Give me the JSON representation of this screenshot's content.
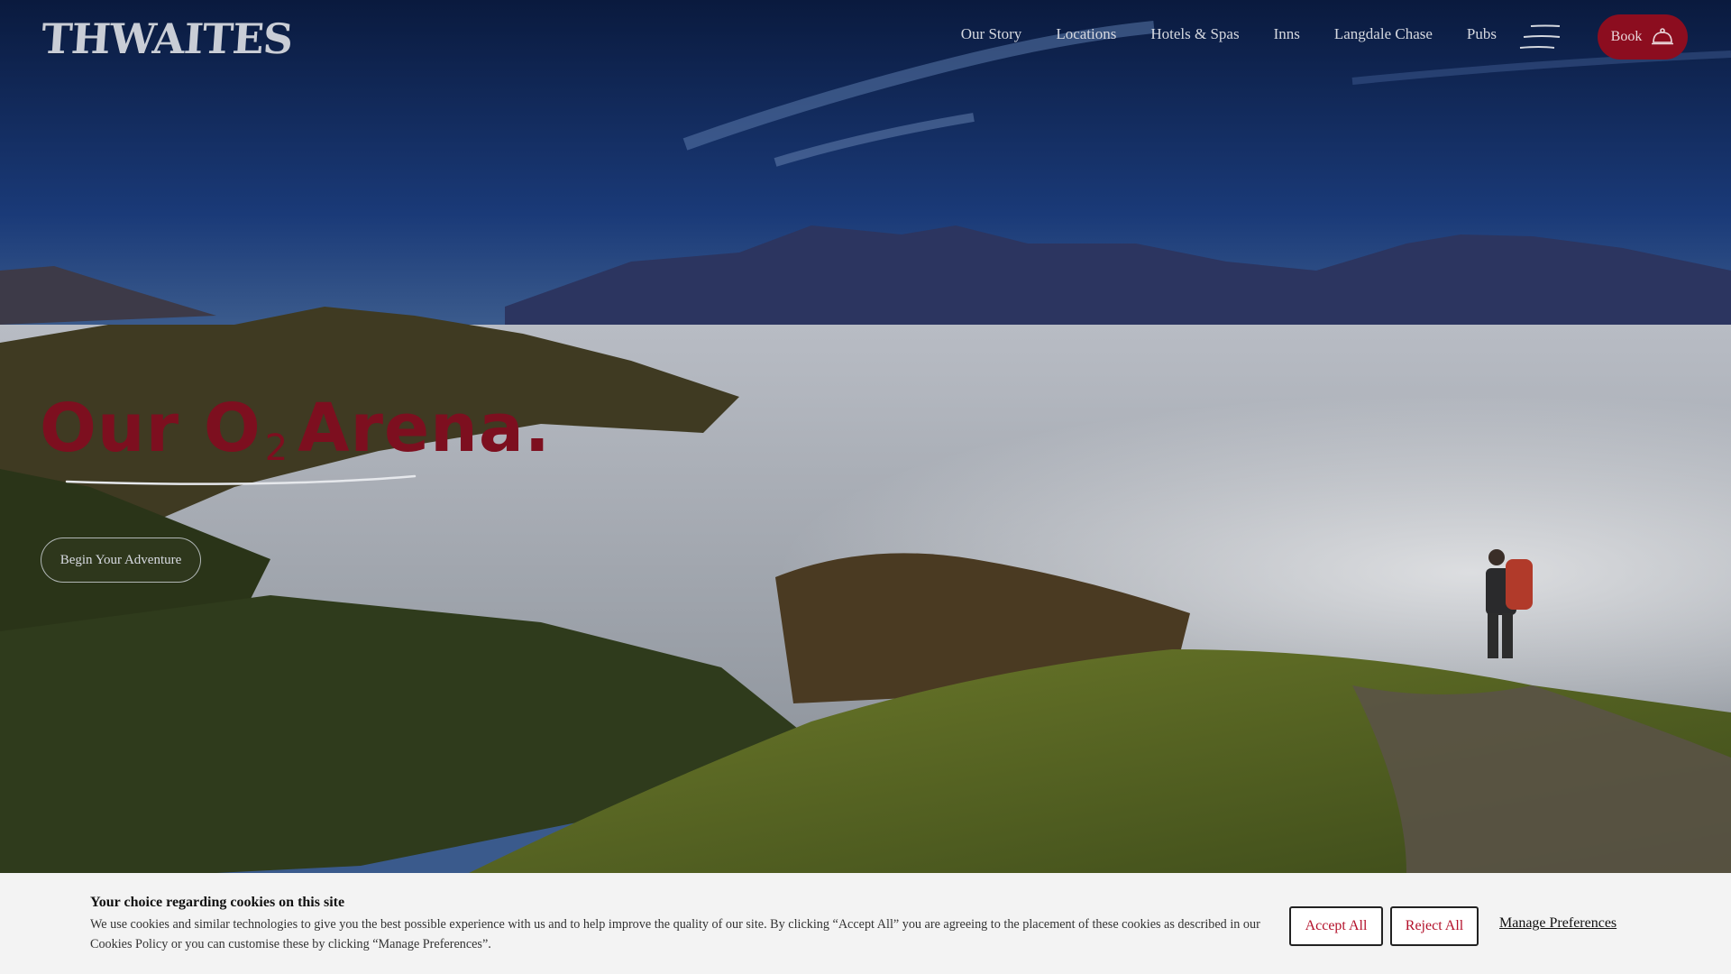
{
  "brand": {
    "logo_text": "THWAITES"
  },
  "nav": {
    "items": [
      "Our Story",
      "Locations",
      "Hotels & Spas",
      "Inns",
      "Langdale Chase",
      "Pubs"
    ],
    "menu_icon": "hamburger-icon",
    "book_label": "Book",
    "book_icon": "service-bell-icon"
  },
  "hero": {
    "headline_part1": "Our O",
    "headline_sub": "2",
    "headline_part2": "Arena.",
    "cta_label": "Begin Your Adventure",
    "image_alt": "Hiker overlooking misty valley and mountains"
  },
  "cookie": {
    "title": "Your choice regarding cookies on this site",
    "text": "We use cookies and similar technologies to give you the best possible experience with us and to help improve the quality of our site. By clicking “Accept All” you are agreeing to the placement of these cookies as described in our Cookies Policy or you can customise these by clicking “Manage Preferences”.",
    "accept_label": "Accept All",
    "reject_label": "Reject All",
    "manage_label": "Manage Preferences"
  },
  "colors": {
    "brand_red": "#8c0d1f",
    "headline_red": "#7d0f1f",
    "sky_dark": "#0e1e3a"
  }
}
